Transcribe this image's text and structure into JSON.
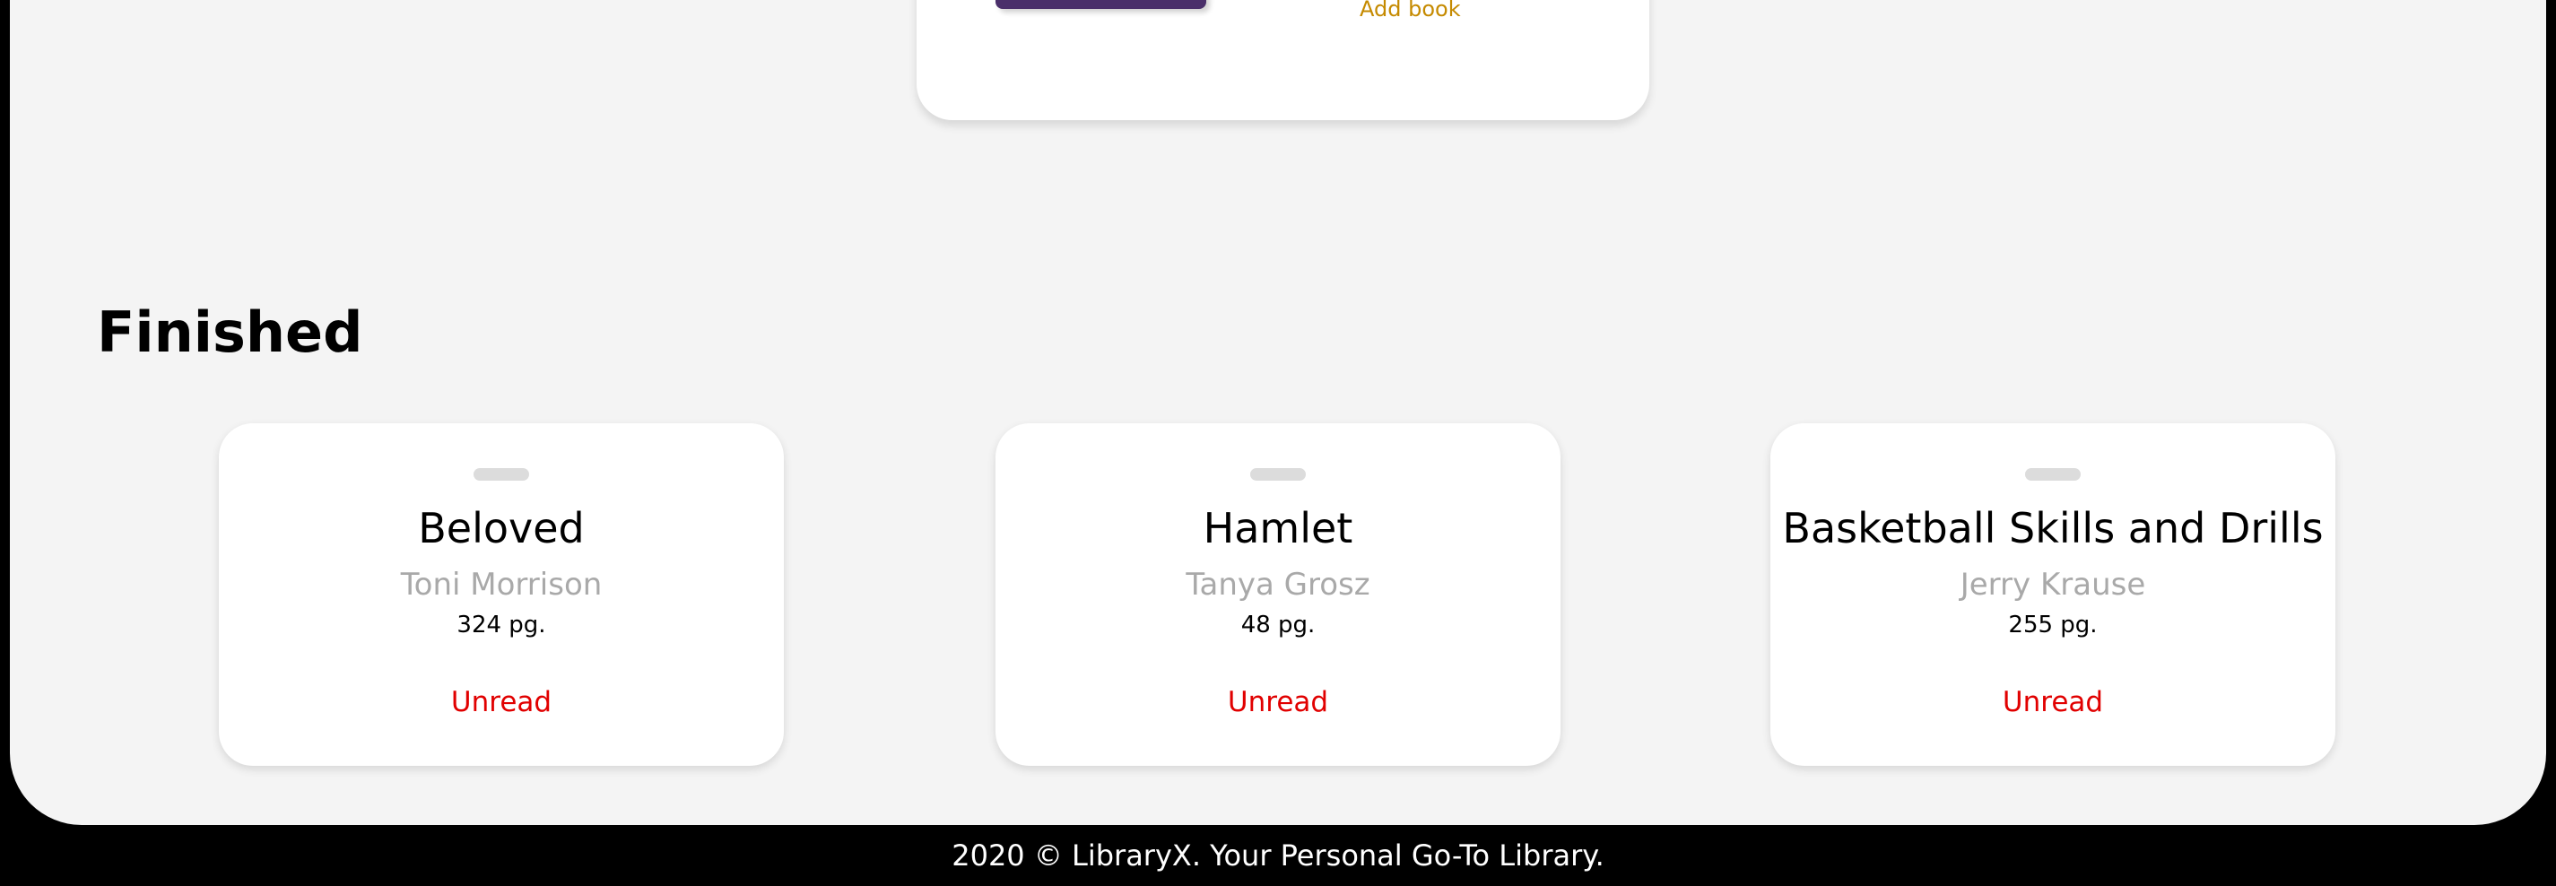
{
  "top_card": {
    "add_book_label": "Add book"
  },
  "finished_section": {
    "title": "Finished",
    "books": [
      {
        "title": "Beloved",
        "author": "Toni Morrison",
        "pages": "324 pg.",
        "status": "Unread"
      },
      {
        "title": "Hamlet",
        "author": "Tanya Grosz",
        "pages": "48 pg.",
        "status": "Unread"
      },
      {
        "title": "Basketball Skills and Drills",
        "author": "Jerry Krause",
        "pages": "255 pg.",
        "status": "Unread"
      }
    ]
  },
  "footer": {
    "text": "2020 © LibraryX. Your Personal Go-To Library."
  },
  "colors": {
    "page_background": "#f4f4f4",
    "frame": "#000000",
    "card": "#ffffff",
    "status_unread": "#e10000",
    "add_link": "#c58a00",
    "author_text": "#a9a9a9"
  }
}
